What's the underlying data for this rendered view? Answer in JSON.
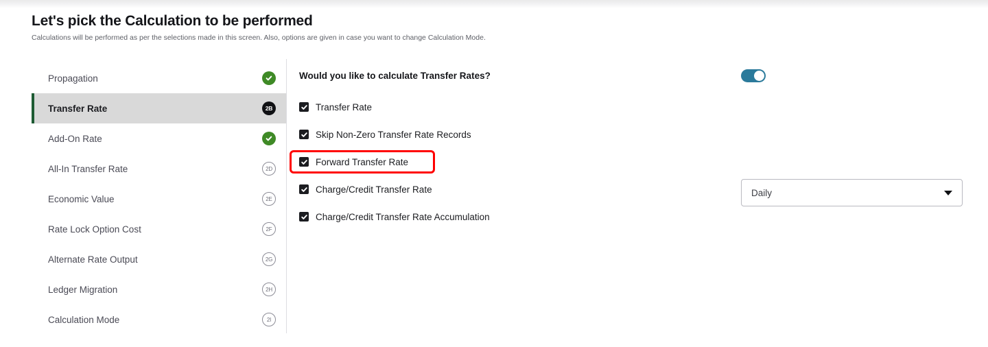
{
  "header": {
    "title": "Let's pick the Calculation to be performed",
    "subtitle": "Calculations will be performed as per the selections made in this screen. Also, options are given in case you want to change Calculation Mode."
  },
  "sidebar": {
    "items": [
      {
        "label": "Propagation",
        "badge": "",
        "state": "done",
        "icon": "check-circle-icon"
      },
      {
        "label": "Transfer Rate",
        "badge": "2B",
        "state": "current",
        "icon": "step-badge-icon"
      },
      {
        "label": "Add-On Rate",
        "badge": "",
        "state": "done",
        "icon": "check-circle-icon"
      },
      {
        "label": "All-In Transfer Rate",
        "badge": "2D",
        "state": "todo",
        "icon": "step-badge-icon"
      },
      {
        "label": "Economic Value",
        "badge": "2E",
        "state": "todo",
        "icon": "step-badge-icon"
      },
      {
        "label": "Rate Lock Option Cost",
        "badge": "2F",
        "state": "todo",
        "icon": "step-badge-icon"
      },
      {
        "label": "Alternate Rate Output",
        "badge": "2G",
        "state": "todo",
        "icon": "step-badge-icon"
      },
      {
        "label": "Ledger Migration",
        "badge": "2H",
        "state": "todo",
        "icon": "step-badge-icon"
      },
      {
        "label": "Calculation Mode",
        "badge": "2I",
        "state": "todo",
        "icon": "step-badge-icon"
      }
    ]
  },
  "main": {
    "question": "Would you like to calculate Transfer Rates?",
    "checkboxes": [
      {
        "label": "Transfer Rate",
        "checked": true
      },
      {
        "label": "Skip Non-Zero Transfer Rate Records",
        "checked": true
      },
      {
        "label": "Forward Transfer Rate",
        "checked": true,
        "highlighted": true
      },
      {
        "label": "Charge/Credit Transfer Rate",
        "checked": true
      },
      {
        "label": "Charge/Credit Transfer Rate Accumulation",
        "checked": true
      }
    ],
    "toggle": {
      "on": true
    },
    "dropdown": {
      "value": "Daily"
    }
  },
  "colors": {
    "accent_green": "#1d5b33",
    "done_green": "#3f8a26",
    "toggle_teal": "#2b7a9b",
    "annotation_red": "#ff0000",
    "active_row_bg": "#d9d9d9"
  }
}
